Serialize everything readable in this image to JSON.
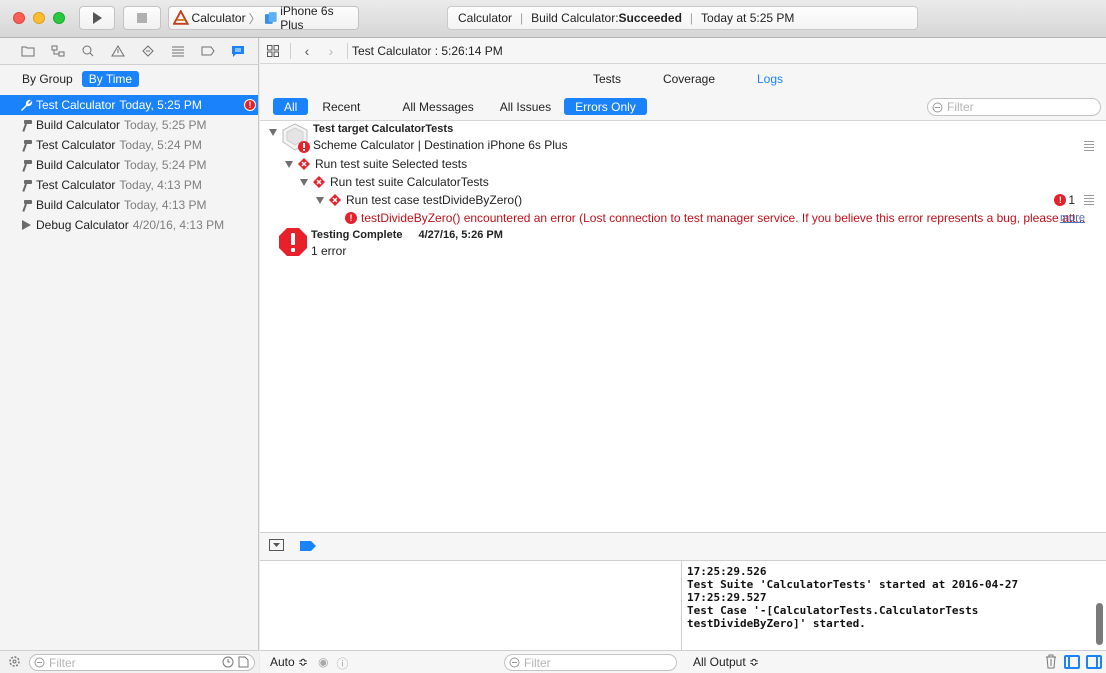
{
  "toolbar": {
    "scheme_name": "Calculator",
    "destination": "iPhone 6s Plus",
    "activity_project": "Calculator",
    "activity_status_prefix": "Build Calculator: ",
    "activity_status": "Succeeded",
    "activity_time": "Today at 5:25 PM"
  },
  "navigator": {
    "seg_group": "By Group",
    "seg_time": "By Time",
    "items": [
      {
        "name": "Test Calculator",
        "date": "Today, 5:25 PM",
        "icon": "wrench-icon",
        "selected": true,
        "error_badge": "!"
      },
      {
        "name": "Build Calculator",
        "date": "Today, 5:25 PM",
        "icon": "hammer-icon"
      },
      {
        "name": "Test Calculator",
        "date": "Today, 5:24 PM",
        "icon": "hammer-icon"
      },
      {
        "name": "Build Calculator",
        "date": "Today, 5:24 PM",
        "icon": "hammer-icon"
      },
      {
        "name": "Test Calculator",
        "date": "Today, 4:13 PM",
        "icon": "hammer-icon"
      },
      {
        "name": "Build Calculator",
        "date": "Today, 4:13 PM",
        "icon": "hammer-icon"
      },
      {
        "name": "Debug Calculator",
        "date": "4/20/16, 4:13 PM",
        "icon": "play-icon"
      }
    ],
    "filter_placeholder": "Filter"
  },
  "editor": {
    "jump_title": "Test Calculator : 5:26:14 PM",
    "tabs": [
      {
        "label": "Tests"
      },
      {
        "label": "Coverage"
      },
      {
        "label": "Logs",
        "active": true
      }
    ],
    "filters": {
      "all": "All",
      "recent": "Recent",
      "all_messages": "All Messages",
      "all_issues": "All Issues",
      "errors_only": "Errors Only",
      "search_placeholder": "Filter"
    },
    "log": {
      "target_title": "Test target CalculatorTests",
      "target_subtitle": "Scheme Calculator | Destination iPhone 6s Plus",
      "suite_selected": "Run test suite Selected tests",
      "suite_calc": "Run test suite CalculatorTests",
      "test_case": "Run test case testDivideByZero()",
      "test_case_count": "1",
      "error_message": "testDivideByZero() encountered an error (Lost connection to test manager service. If you believe this error represents a bug, please att...",
      "more": "more",
      "complete_title": "Testing Complete",
      "complete_time": "4/27/16, 5:26 PM",
      "complete_summary": "1 error"
    }
  },
  "debug": {
    "console_text": "17:25:29.526\nTest Suite 'CalculatorTests' started at 2016-04-27\n17:25:29.527\nTest Case '-[CalculatorTests.CalculatorTests\ntestDivideByZero]' started.",
    "auto_label": "Auto ≎",
    "filter_placeholder": "Filter",
    "output_label": "All Output ≎"
  },
  "colors": {
    "accent": "#1a82fb",
    "error": "#e8202a",
    "error_text": "#c0101a"
  }
}
